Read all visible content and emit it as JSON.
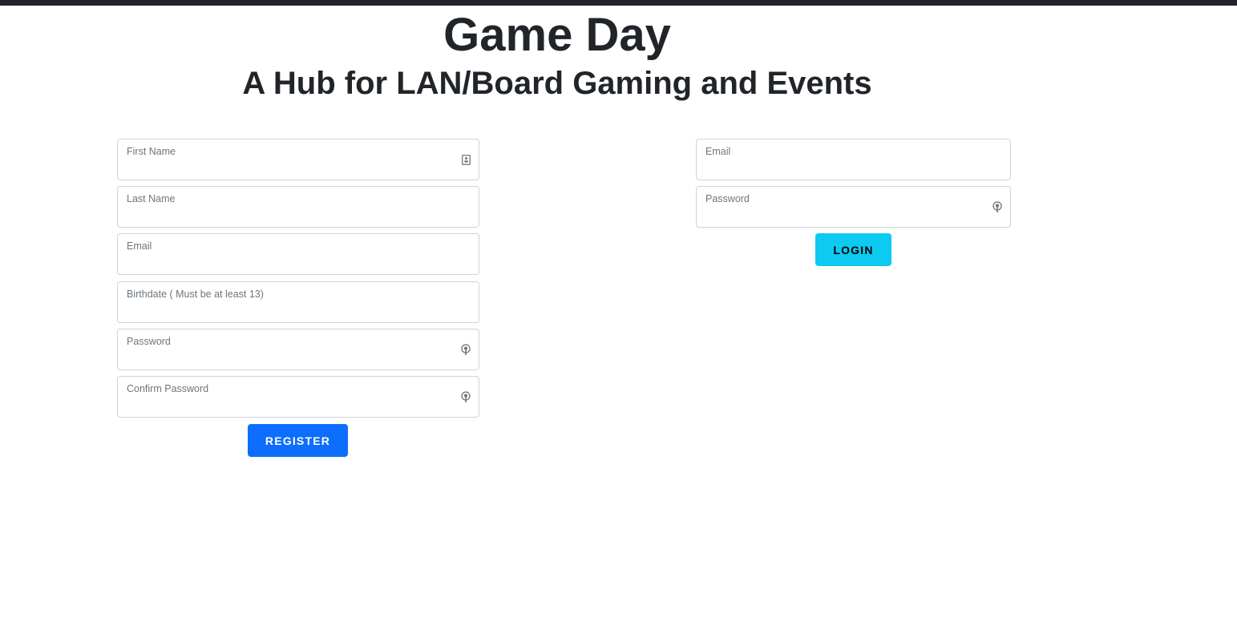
{
  "header": {
    "title": "Game Day",
    "subtitle": "A Hub for LAN/Board Gaming and Events"
  },
  "register_form": {
    "fields": {
      "first_name": {
        "label": "First Name",
        "icon": "contact-card-icon"
      },
      "last_name": {
        "label": "Last Name"
      },
      "email": {
        "label": "Email"
      },
      "birthdate": {
        "label": "Birthdate ( Must be at least 13)"
      },
      "password": {
        "label": "Password",
        "icon": "password-key-icon"
      },
      "confirm_password": {
        "label": "Confirm Password",
        "icon": "password-key-icon"
      }
    },
    "submit_label": "REGISTER"
  },
  "login_form": {
    "fields": {
      "email": {
        "label": "Email"
      },
      "password": {
        "label": "Password",
        "icon": "password-key-icon"
      }
    },
    "submit_label": "LOGIN"
  },
  "colors": {
    "register_button": "#0d6efd",
    "login_button": "#0dcaf0",
    "top_bar": "#212529",
    "field_border": "#ced4da",
    "label_text": "#6c757d"
  }
}
